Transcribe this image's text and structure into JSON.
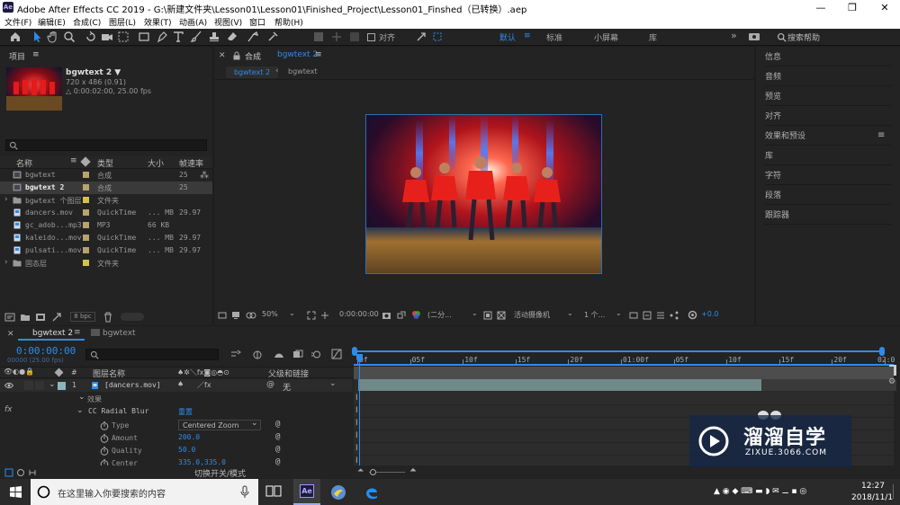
{
  "window": {
    "title": "Adobe After Effects CC 2019 - G:\\新建文件夹\\Lesson01\\Lesson01\\Finished_Project\\Lesson01_Finshed（已转换）.aep",
    "app_icon": "Ae",
    "min": "—",
    "max": "❐",
    "close": "✕"
  },
  "menu": [
    "文件(F)",
    "编辑(E)",
    "合成(C)",
    "图层(L)",
    "效果(T)",
    "动画(A)",
    "视图(V)",
    "窗口",
    "帮助(H)"
  ],
  "toolbar": {
    "align_label": "对齐",
    "workspaces": [
      "默认",
      "标准",
      "小屏幕",
      "库"
    ],
    "active_workspace": "默认",
    "more": "»",
    "search_placeholder": "搜索帮助"
  },
  "project": {
    "title": "项目",
    "comp_name": "bgwtext 2 ▼",
    "comp_dims": "720 x 486 (0.91)",
    "comp_duration": "△ 0:00:02:00, 25.00 fps",
    "columns": [
      "名称",
      "类型",
      "大小",
      "帧速率"
    ],
    "items": [
      {
        "name": "bgwtext",
        "type": "合成",
        "size": "",
        "fps": "25",
        "color": "#b8a26e",
        "kind": "comp"
      },
      {
        "name": "bgwtext 2",
        "type": "合成",
        "size": "",
        "fps": "25",
        "color": "#b8a26e",
        "kind": "comp",
        "selected": true
      },
      {
        "name": "bgwtext 个图层",
        "type": "文件夹",
        "size": "",
        "fps": "",
        "color": "#d4c04a",
        "kind": "folder"
      },
      {
        "name": "dancers.mov",
        "type": "QuickTime",
        "size": "... MB",
        "fps": "29.97",
        "color": "#b8a26e",
        "kind": "file"
      },
      {
        "name": "gc_adob...mp3",
        "type": "MP3",
        "size": "66 KB",
        "fps": "",
        "color": "#b8a26e",
        "kind": "file"
      },
      {
        "name": "kaleido...mov",
        "type": "QuickTime",
        "size": "... MB",
        "fps": "29.97",
        "color": "#b8a26e",
        "kind": "file"
      },
      {
        "name": "pulsati...mov",
        "type": "QuickTime",
        "size": "... MB",
        "fps": "29.97",
        "color": "#b8a26e",
        "kind": "file"
      },
      {
        "name": "固态层",
        "type": "文件夹",
        "size": "",
        "fps": "",
        "color": "#d4c04a",
        "kind": "folder"
      }
    ],
    "bpc": "8 bpc"
  },
  "comp": {
    "panel_label": "合成",
    "panel_comp": "bgwtext 2",
    "tabs": [
      "bgwtext 2",
      "bgwtext"
    ],
    "zoom": "50%",
    "timecode": "0:00:00:00",
    "resolution": "(二分...",
    "camera": "活动摄像机",
    "views": "1 个...",
    "exposure": "+0.0"
  },
  "right_panels": [
    "信息",
    "音频",
    "预览",
    "对齐",
    "效果和预设",
    "库",
    "字符",
    "段落",
    "跟踪器"
  ],
  "timeline": {
    "tabs": [
      "bgwtext 2",
      "bgwtext"
    ],
    "current_time": "0:00:00:00",
    "frame_info": "00000 (25.00 fps)",
    "col_layer": "图层名称",
    "col_parent": "父级和链接",
    "ticks": [
      "0f",
      "05f",
      "10f",
      "15f",
      "20f",
      "01:00f",
      "05f",
      "10f",
      "15f",
      "20f",
      "02:0"
    ],
    "layer": {
      "num": "1",
      "name": "[dancers.mov]",
      "parent": "无"
    },
    "effects_label": "效果",
    "fx_label": "fx",
    "effect_name": "CC Radial Blur",
    "reset": "重置",
    "props": [
      {
        "name": "Type",
        "value": "Centered Zoom"
      },
      {
        "name": "Amount",
        "value": "200.0"
      },
      {
        "name": "Quality",
        "value": "50.0"
      },
      {
        "name": "Center",
        "value": "335.0,335.0"
      }
    ],
    "switch_mode": "切换开关/模式"
  },
  "watermark": {
    "brand": "溜溜自学",
    "url": "ZIXUE.3066.COM"
  },
  "taskbar": {
    "search_placeholder": "在这里输入你要搜索的内容",
    "time": "12:27",
    "date": "2018/11/1"
  }
}
